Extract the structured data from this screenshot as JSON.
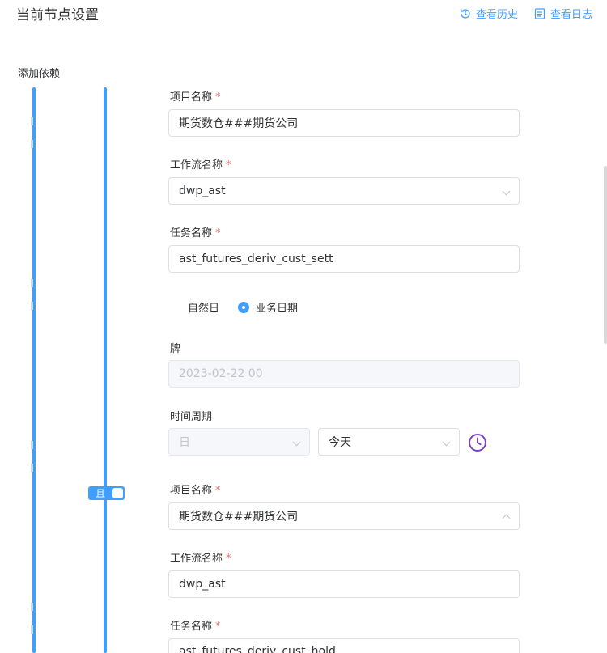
{
  "header": {
    "title": "当前节点设置",
    "view_history": "查看历史",
    "view_log": "查看日志"
  },
  "section": {
    "label": "添加依赖"
  },
  "dependencies": [
    {
      "project_label": "项目名称",
      "project_value": "期货数仓###期货公司",
      "workflow_label": "工作流名称",
      "workflow_value": "dwp_ast",
      "task_label": "任务名称",
      "task_value": "ast_futures_deriv_cust_sett",
      "radio_natural": "自然日",
      "radio_business": "业务日期",
      "date_label": "牌",
      "date_value": "2023-02-22 00",
      "period_label": "时间周期",
      "period_unit": "日",
      "period_value": "今天"
    },
    {
      "project_label": "项目名称",
      "project_value": "期货数仓###期货公司",
      "workflow_label": "工作流名称",
      "workflow_value": "dwp_ast",
      "task_label": "任务名称",
      "task_value": "ast_futures_deriv_cust_hold"
    }
  ],
  "relation": {
    "label": "且"
  },
  "required_mark": "*",
  "colors": {
    "accent": "#409eff",
    "required": "#f56c6c",
    "clock": "#7b3fbf"
  },
  "icons": {
    "history": "history-icon",
    "log": "log-icon",
    "clock": "clock-icon"
  }
}
